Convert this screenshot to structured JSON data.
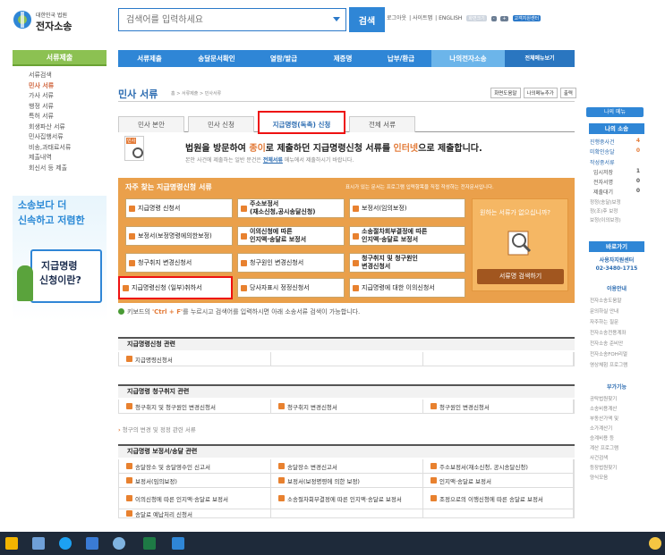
{
  "logo": {
    "small": "대한민국 법원",
    "name": "전자소송"
  },
  "search": {
    "placeholder": "검색어를 입력하세요",
    "button": "검색"
  },
  "toplinks": [
    "로그아웃",
    "사이트맵",
    "ENGLISH"
  ],
  "topchips": [
    "화면크기",
    "-",
    "+",
    "고객지원센터"
  ],
  "sidebar": {
    "title": "서류제출",
    "items": [
      "서류검색",
      "민사 서류",
      "가사 서류",
      "행정 서류",
      "특허 서류",
      "회생파산 서류",
      "민사집행서류",
      "비송,과태료서류",
      "제출내역",
      "회신서 등 제출"
    ],
    "active_index": 1
  },
  "promo": {
    "line1": "소송보다 더",
    "line2": "신속하고 저렴한",
    "line3": "지급명령",
    "line4": "신청이란?"
  },
  "nav": [
    "서류제출",
    "송달문서확인",
    "열람/발급",
    "제증명",
    "납부/환급",
    "나의전자소송",
    "전체메뉴보기"
  ],
  "page": {
    "title": "민사 서류",
    "breadcrumb": "홈 > 서류제출 > 민사서류",
    "tools": [
      "화면도움말",
      "나의메뉴추가",
      "출력"
    ]
  },
  "tabs": [
    "민사 본안",
    "민사 신청",
    "지급명령(독촉) 신청",
    "전체 서류"
  ],
  "notice": {
    "icon_label": "민사",
    "pre": "법원을 방문하여 ",
    "hi1": "종이",
    "mid": "로 제출하던 지급명령신청 서류를 ",
    "hi2": "인터넷",
    "post": "으로 제출합니다.",
    "sub_pre": "본안 사건에 제출하는 일반 문건은 ",
    "sub_link": "전체서류",
    "sub_post": " 메뉴에서 제출하시기 바랍니다."
  },
  "fav": {
    "title": "자주 찾는 지급명령신청 서류",
    "note": "표시가 있는 문서는 프로그램 입력항목을 직접 작성하는 전자문서입니다.",
    "side_q": "원하는 서류가 없으십니까?",
    "side_btn": "서류명 검색하기",
    "buttons": [
      "지급명령 신청서",
      "주소보정서\n(재소신청,공시송달신청)",
      "보정서(임의보정)",
      "보정서(보정명령에의한보정)",
      "이의신청에 따른\n인지액·송달료 보정서",
      "소송절차회부결정에 따른\n인지액·송달료 보정서",
      "청구취지 변경신청서",
      "청구원인 변경신청서",
      "청구취지 및 청구원인\n변경신청서",
      "지급명령신청 (일부)취하서",
      "당사자표시 정정신청서",
      "지급명령에 대한 이의신청서"
    ]
  },
  "tip": {
    "pre": "키보드의 ",
    "key": "'Ctrl + F'",
    "post": "를 누르시고 검색어를 입력하시면 아래 소송서류 검색이 가능합니다."
  },
  "sections": [
    {
      "title": "지급명령신청 관련",
      "rows": [
        [
          "지급명령신청서",
          "",
          ""
        ]
      ]
    },
    {
      "title": "지급명령 청구취지 관련",
      "rows": [
        [
          "청구취지 및 청구원인 변경신청서",
          "청구취지 변경신청서",
          "청구원인 변경신청서"
        ]
      ]
    },
    {
      "title": "지급명령 보정서/송달 관련",
      "rows": [
        [
          "송달장소 및 송달영수인 신고서",
          "송달장소 변경신고서",
          "주소보정서(재소신청, 공시송달신청)"
        ],
        [
          "보정서(임의보정)",
          "보정서(보정명령에 의한 보정)",
          "인지액·송달료 보정서"
        ],
        [
          "이의신청에 따른 인지액·송달료 보정서",
          "소송절차회부결정에 따른 인지액·송달료 보정서",
          "조정으로의 이행신청에 따른 송달료 보정서"
        ],
        [
          "송달료 예납처리 신청서",
          "",
          ""
        ]
      ]
    }
  ],
  "more_link": {
    "bullet": "›",
    "text": "청구의 변경 및 정정 관련 서류"
  },
  "right": {
    "mymenu": "나의 메뉴",
    "mycase": "나의 소송",
    "stats": [
      [
        "진행중사건",
        "4"
      ],
      [
        "미확인송달",
        "0"
      ]
    ],
    "draft": "작성중서류",
    "drafts": [
      [
        "임시저장",
        "1"
      ],
      [
        "전자서명",
        "0"
      ],
      [
        "제출대기",
        "0"
      ]
    ],
    "extra": [
      "정정(송달)보정",
      "정(조)후 보정",
      "보정(이의보정)"
    ],
    "shortcut": "바로가기",
    "helpdesk": "사용자지원센터",
    "phone": "02-3480-1715",
    "guide": "이용안내",
    "guides": [
      "전자소송도움말",
      "문의하실 안내",
      "자주하는 질문",
      "전자소송전용계좌",
      "전자소송 준비안",
      "전자소송FOH리얼",
      "영상체험 프로그램"
    ],
    "extra_title": "부가기능",
    "extras": [
      "공탁법원찾기",
      "소송비용계산",
      "부동산가액 및",
      "소가계산기",
      "승계비용 등",
      "계산 프로그램",
      "사건검색",
      "등장법원찾기",
      "양식모음"
    ]
  }
}
